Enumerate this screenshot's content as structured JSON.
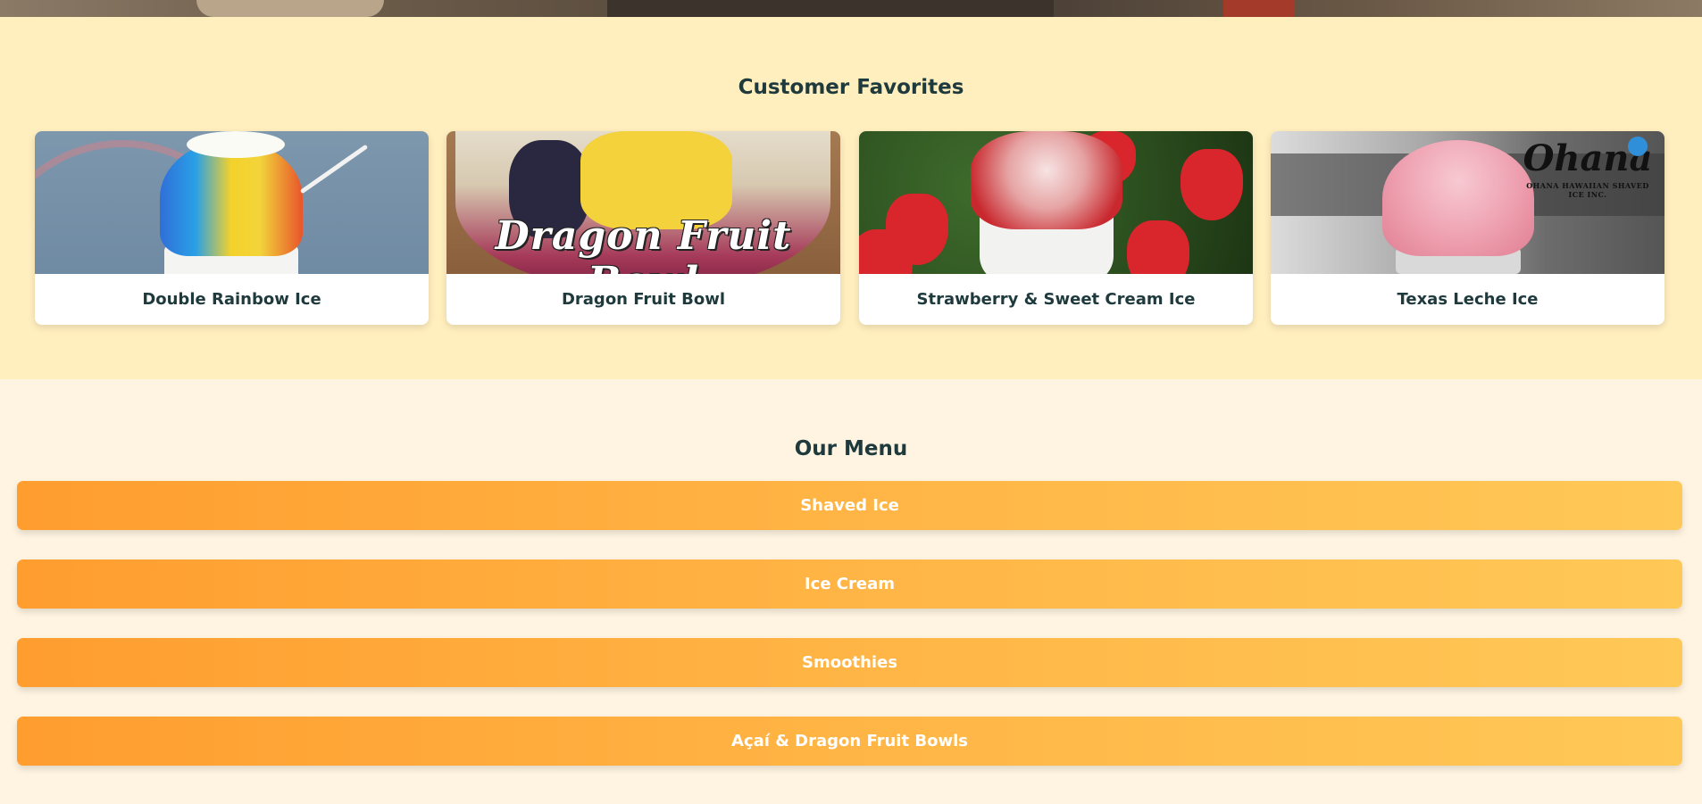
{
  "favorites": {
    "title": "Customer Favorites",
    "cards": [
      {
        "label": "Double Rainbow Ice"
      },
      {
        "label": "Dragon Fruit Bowl",
        "image_text": "Dragon Fruit Bowl"
      },
      {
        "label": "Strawberry & Sweet Cream Ice"
      },
      {
        "label": "Texas Leche Ice",
        "logo_text": "Ohana",
        "logo_subtext": "OHANA HAWAIIAN SHAVED ICE INC."
      }
    ]
  },
  "menu": {
    "title": "Our Menu",
    "items": [
      {
        "label": "Shaved Ice"
      },
      {
        "label": "Ice Cream"
      },
      {
        "label": "Smoothies"
      },
      {
        "label": "Açaí & Dragon Fruit Bowls"
      }
    ]
  },
  "colors": {
    "favorites_background": "#ffeebe",
    "menu_background": "#fff4e1",
    "button_gradient_start": "#ff9d2f",
    "button_gradient_end": "#ffc857",
    "heading_text": "#1f3a3d"
  }
}
